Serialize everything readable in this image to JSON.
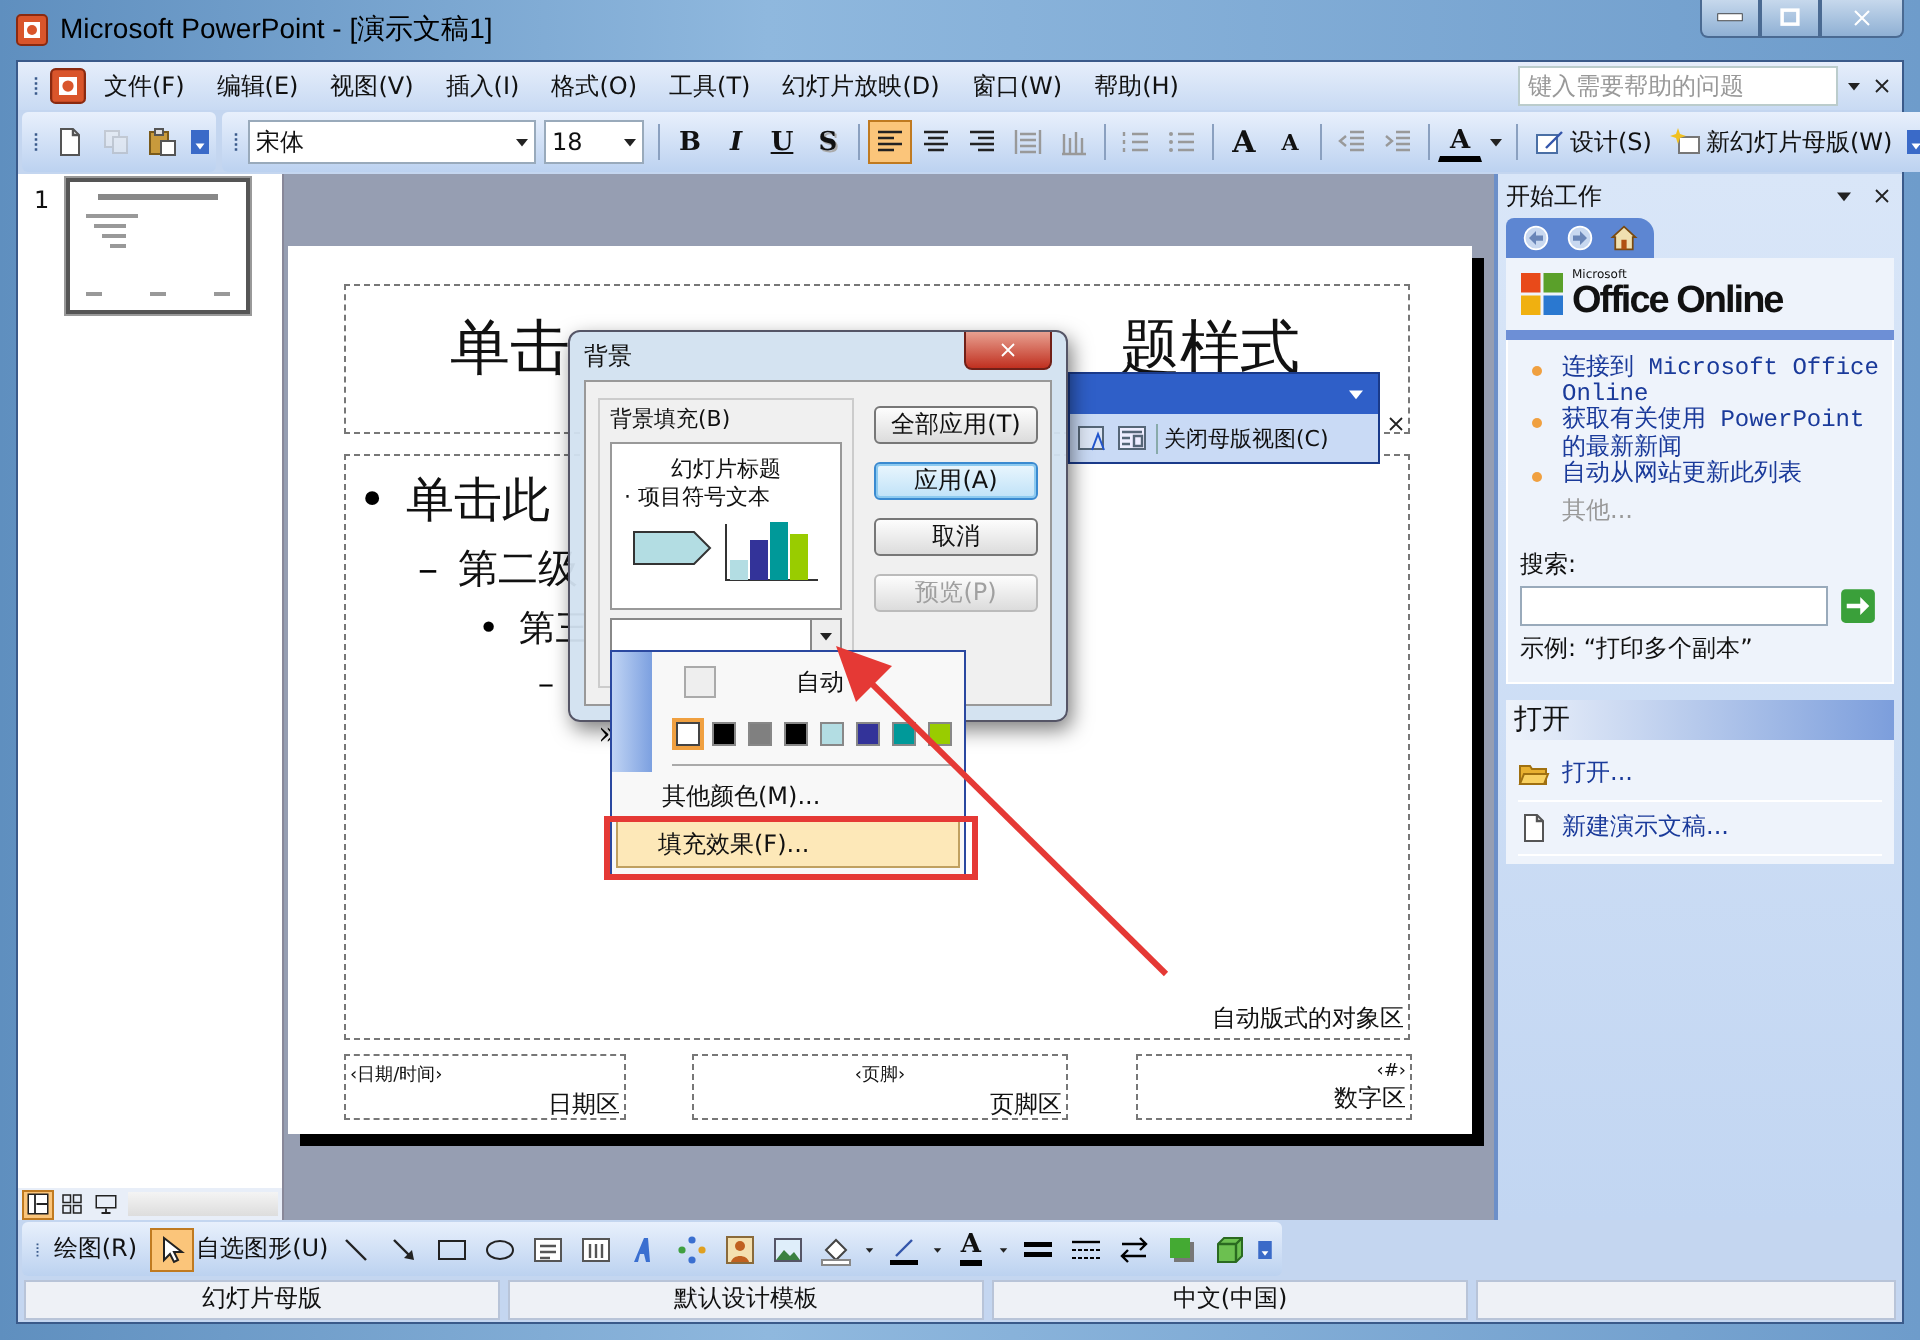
{
  "window": {
    "title": "Microsoft PowerPoint - [演示文稿1]"
  },
  "menu": {
    "items": [
      "文件(F)",
      "编辑(E)",
      "视图(V)",
      "插入(I)",
      "格式(O)",
      "工具(T)",
      "幻灯片放映(D)",
      "窗口(W)",
      "帮助(H)"
    ],
    "help": {
      "placeholder": "键入需要帮助的问题"
    }
  },
  "toolbar": {
    "standard": [
      {
        "kind": "new",
        "disabled": false
      },
      {
        "kind": "copy",
        "disabled": true
      },
      {
        "kind": "paste",
        "disabled": false
      }
    ],
    "font": "宋体",
    "size": "18",
    "styles": [
      {
        "kind": "bold",
        "label": "B"
      },
      {
        "kind": "italic",
        "label": "I"
      },
      {
        "kind": "underline",
        "label": "U"
      },
      {
        "kind": "shadow",
        "label": "S"
      }
    ],
    "align": [
      {
        "kind": "left",
        "selected": true
      },
      {
        "kind": "center",
        "selected": false
      },
      {
        "kind": "right",
        "selected": false
      },
      {
        "kind": "justify",
        "selected": false
      },
      {
        "kind": "distribute",
        "selected": false
      }
    ],
    "lists": [
      {
        "kind": "numbering"
      },
      {
        "kind": "bullets"
      }
    ],
    "sizes": [
      {
        "kind": "grow",
        "label": "A"
      },
      {
        "kind": "shrink",
        "label": "A"
      }
    ],
    "indent": [
      {
        "kind": "decrease"
      },
      {
        "kind": "increase"
      }
    ],
    "font_color": {
      "label": "A"
    },
    "commands": [
      {
        "kind": "design",
        "label": "设计(S)"
      },
      {
        "kind": "newmaster",
        "label": "新幻灯片母版(W)"
      }
    ]
  },
  "thumbnails": [
    {
      "number": "1",
      "selected": true
    }
  ],
  "slide": {
    "title_parts": [
      "单击",
      "题样式"
    ],
    "body": [
      {
        "bullet": "•",
        "text": "单击此",
        "children": [
          {
            "bullet": "–",
            "text": "第二级",
            "children": [
              {
                "bullet": "•",
                "text": "第三",
                "children": [
                  {
                    "bullet": "–",
                    "children": [
                      {
                        "bullet": "»"
                      }
                    ]
                  }
                ]
              }
            ]
          }
        ]
      }
    ],
    "object_area": "自动版式的对象区",
    "footers": [
      {
        "field": "‹日期/时间›",
        "area": "日期区"
      },
      {
        "field": "‹页脚›",
        "area": "页脚区"
      },
      {
        "field": "‹#›",
        "area": "数字区"
      }
    ]
  },
  "master_toolbar": {
    "close": "关闭母版视图(C)"
  },
  "dialog": {
    "title": "背景",
    "group": "背景填充(B)",
    "preview": {
      "title": "幻灯片标题",
      "bullet": "· 项目符号文本"
    },
    "buttons": [
      {
        "label": "全部应用(T)",
        "default": false,
        "disabled": false
      },
      {
        "label": "应用(A)",
        "default": true,
        "disabled": false
      },
      {
        "label": "取消",
        "default": false,
        "disabled": false
      },
      {
        "label": "预览(P)",
        "default": false,
        "disabled": true
      }
    ]
  },
  "color_menu": {
    "auto": "自动",
    "colors": [
      {
        "color": "#ffffff",
        "selected": true
      },
      {
        "color": "#000000",
        "selected": false
      },
      {
        "color": "#808080",
        "selected": false
      },
      {
        "color": "#000000",
        "selected": false
      },
      {
        "color": "#b3dde3",
        "selected": false
      },
      {
        "color": "#333399",
        "selected": false
      },
      {
        "color": "#009999",
        "selected": false
      },
      {
        "color": "#99cc00",
        "selected": false
      }
    ],
    "items": [
      {
        "label": "其他颜色(M)...",
        "selected": false
      },
      {
        "label": "填充效果(F)...",
        "selected": true
      }
    ]
  },
  "task_pane": {
    "title": "开始工作",
    "logo": {
      "small": "Microsoft",
      "big": "Office Online"
    },
    "links": [
      "连接到 Microsoft Office Online",
      "获取有关使用 PowerPoint 的最新新闻",
      "自动从网站更新此列表"
    ],
    "more": "其他...",
    "search_label": "搜索:",
    "example": "示例: “打印多个副本”",
    "section": "打开",
    "items": [
      {
        "kind": "open",
        "label": "打开..."
      },
      {
        "kind": "newdoc",
        "label": "新建演示文稿..."
      }
    ]
  },
  "views": [
    {
      "kind": "normal",
      "selected": true
    },
    {
      "kind": "sorter",
      "selected": false
    },
    {
      "kind": "show",
      "selected": false
    }
  ],
  "drawing_toolbar": {
    "draw": "绘图(R)",
    "autoshapes": "自选图形(U)",
    "tools": [
      {
        "kind": "select",
        "selected": true
      },
      {
        "kind": "line",
        "selected": false
      },
      {
        "kind": "arrow",
        "selected": false
      },
      {
        "kind": "rect",
        "selected": false
      },
      {
        "kind": "oval",
        "selected": false
      },
      {
        "kind": "textbox",
        "selected": false
      },
      {
        "kind": "vtextbox",
        "selected": false
      },
      {
        "kind": "wordart",
        "selected": false
      },
      {
        "kind": "diagram",
        "selected": false
      },
      {
        "kind": "clipart",
        "selected": false
      },
      {
        "kind": "picture",
        "selected": false
      },
      {
        "kind": "fill",
        "selected": false
      },
      {
        "kind": "linecolor",
        "selected": false
      },
      {
        "kind": "fontcolor",
        "label": "A",
        "selected": false
      },
      {
        "kind": "linestyle",
        "selected": false
      },
      {
        "kind": "dashstyle",
        "selected": false
      },
      {
        "kind": "arrowstyle",
        "selected": false
      },
      {
        "kind": "shadow",
        "selected": false
      },
      {
        "kind": "threed",
        "selected": false
      }
    ]
  },
  "status": [
    "幻灯片母版",
    "默认设计模板",
    "中文(中国)"
  ]
}
